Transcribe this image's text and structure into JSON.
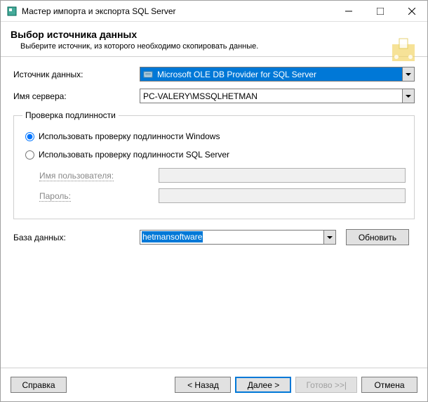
{
  "window": {
    "title": "Мастер импорта и экспорта SQL Server",
    "minimize": "—",
    "maximize": "☐",
    "close": "✕"
  },
  "header": {
    "title": "Выбор источника данных",
    "subtitle": "Выберите источник, из которого необходимо скопировать данные."
  },
  "form": {
    "datasource_label": "Источник данных:",
    "datasource_value": "Microsoft OLE DB Provider for SQL Server",
    "server_label": "Имя сервера:",
    "server_value": "PC-VALERY\\MSSQLHETMAN"
  },
  "auth": {
    "group_title": "Проверка подлинности",
    "windows_label": "Использовать проверку подлинности Windows",
    "sql_label": "Использовать проверку подлинности SQL Server",
    "user_label": "Имя пользователя:",
    "password_label": "Пароль:"
  },
  "db": {
    "label": "База данных:",
    "value": "hetmansoftware",
    "refresh": "Обновить"
  },
  "footer": {
    "help": "Справка",
    "back": "< Назад",
    "next": "Далее >",
    "finish": "Готово >>|",
    "cancel": "Отмена"
  }
}
